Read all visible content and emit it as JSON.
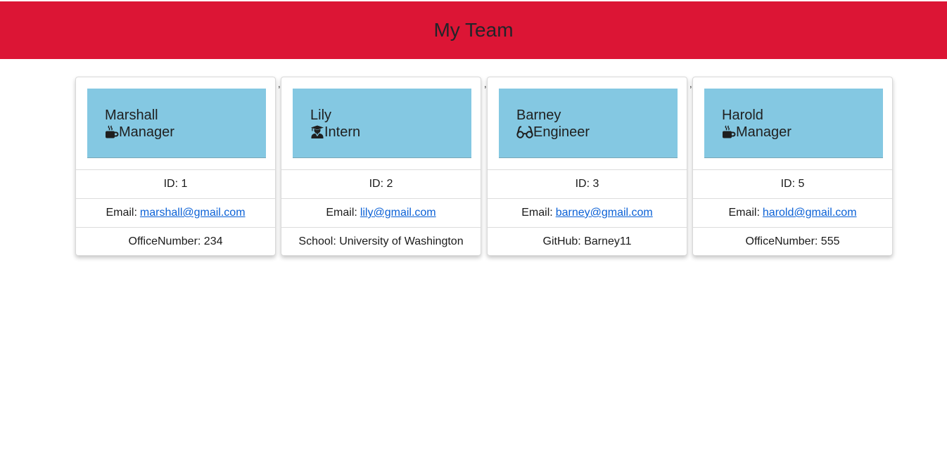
{
  "page": {
    "title": "My Team"
  },
  "separator": ",",
  "team": [
    {
      "name": "Marshall",
      "role": "Manager",
      "role_icon": "mug-hot-icon",
      "id_text": "ID: 1",
      "email_label": "Email:",
      "email": "marshall@gmail.com",
      "extra": "OfficeNumber: 234"
    },
    {
      "name": "Lily",
      "role": "Intern",
      "role_icon": "user-graduate-icon",
      "id_text": "ID: 2",
      "email_label": "Email:",
      "email": "lily@gmail.com",
      "extra": "School: University of Washington"
    },
    {
      "name": "Barney",
      "role": "Engineer",
      "role_icon": "glasses-icon",
      "id_text": "ID: 3",
      "email_label": "Email:",
      "email": "barney@gmail.com",
      "extra": "GitHub: Barney11"
    },
    {
      "name": "Harold",
      "role": "Manager",
      "role_icon": "mug-hot-icon",
      "id_text": "ID: 5",
      "email_label": "Email:",
      "email": "harold@gmail.com",
      "extra": "OfficeNumber: 555"
    }
  ]
}
